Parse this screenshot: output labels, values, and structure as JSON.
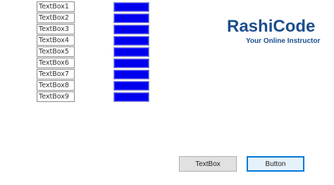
{
  "textboxes": [
    {
      "value": "TextBox1"
    },
    {
      "value": "TextBox2"
    },
    {
      "value": "TextBox3"
    },
    {
      "value": "TextBox4"
    },
    {
      "value": "TextBox5"
    },
    {
      "value": "TextBox6"
    },
    {
      "value": "TextBox7"
    },
    {
      "value": "TextBox8"
    },
    {
      "value": "TextBox9"
    }
  ],
  "blue_boxes_count_visible": 9,
  "brand": {
    "title": "RashiCode",
    "subtitle": "Your Online Instructor",
    "color": "#1c4e8c"
  },
  "buttons": {
    "textbox_label": "TextBox",
    "button_label": "Button"
  },
  "colors": {
    "blue_box": "#0000ee",
    "focus_border": "#0078d7"
  }
}
